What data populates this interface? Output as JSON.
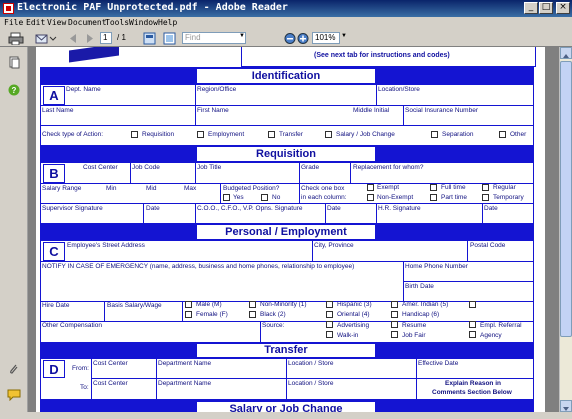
{
  "window": {
    "title": "Electronic PAF Unprotected.pdf - Adobe Reader",
    "min": "_",
    "max": "□",
    "close": "×"
  },
  "menu": [
    "File",
    "Edit",
    "View",
    "Document",
    "Tools",
    "Window",
    "Help"
  ],
  "toolbar": {
    "page_current": "1",
    "page_total": "/ 1",
    "find_placeholder": "Find",
    "zoom": "101%"
  },
  "header_note": "(See next tab for instructions and codes)",
  "identification": {
    "title": "Identification",
    "letter": "A",
    "dept_name": "Dept. Name",
    "region_office": "Region/Office",
    "location_store": "Location/Store",
    "last_name": "Last Name",
    "first_name": "First Name",
    "middle_initial": "Middle Initial",
    "sin": "Social Insurance Number",
    "check_type": "Check type of Action:",
    "actions": [
      "Requisition",
      "Employment",
      "Transfer",
      "Salary / Job Change",
      "Separation",
      "Other"
    ]
  },
  "requisition": {
    "title": "Requisition",
    "letter": "B",
    "cost_center": "Cost Center",
    "job_code": "Job Code",
    "job_title": "Job Title",
    "grade": "Grade",
    "replacement": "Replacement for whom?",
    "salary_range": "Salary Range",
    "min": "Min",
    "mid": "Mid",
    "max": "Max",
    "budgeted": "Budgeted Position?",
    "yes": "Yes",
    "no": "No",
    "check_one": "Check one box",
    "each_column": "in each column:",
    "exempt": "Exempt",
    "non_exempt": "Non-Exempt",
    "full_time": "Full time",
    "part_time": "Part time",
    "regular": "Regular",
    "temporary": "Temporary",
    "supervisor_sig": "Supervisor Signature",
    "date1": "Date",
    "coo_sig": "C.O.O., C.F.O., V.P. Opns. Signature",
    "date2": "Date",
    "hr_sig": "H.R. Signature",
    "date3": "Date"
  },
  "personal": {
    "title": "Personal / Employment",
    "letter": "C",
    "street": "Employee's Street Address",
    "city": "City, Province",
    "postal": "Postal Code",
    "emergency": "NOTIFY IN CASE OF EMERGENCY (name, address, business and home phones, relationship to employee)",
    "home_phone": "Home Phone Number",
    "birth_date": "Birth Date",
    "hire_date": "Hire Date",
    "basis": "Basis Salary/Wage",
    "male": "Male (M)",
    "female": "Female (F)",
    "non_minority": "Non-Minority (1)",
    "black": "Black (2)",
    "hispanic": "Hispanic (3)",
    "oriental": "Oriental (4)",
    "amer_indian": "Amer. Indian (5)",
    "handicap": "Handicap (6)",
    "other_comp": "Other Compensation",
    "source": "Source:",
    "advertising": "Advertising",
    "walk_in": "Walk-in",
    "resume": "Resume",
    "job_fair": "Job Fair",
    "empl_referral": "Empl. Referral",
    "agency": "Agency"
  },
  "transfer": {
    "title": "Transfer",
    "letter": "D",
    "from": "From:",
    "to": "To:",
    "cost_center": "Cost Center",
    "dept_name": "Department Name",
    "location_store": "Location / Store",
    "effective_date": "Effective Date",
    "explain1": "Explain Reason in",
    "explain2": "Comments Section Below"
  },
  "salary_change": {
    "title": "Salary or Job Change"
  }
}
